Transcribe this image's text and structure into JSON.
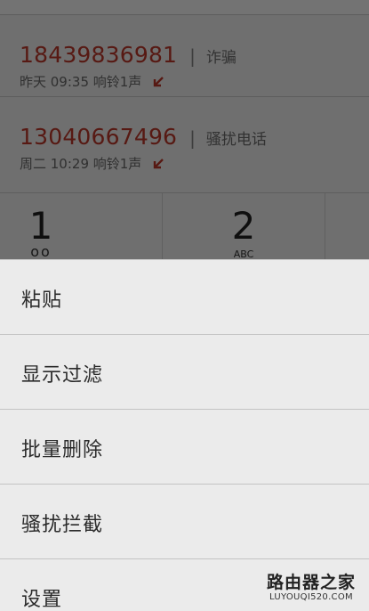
{
  "call_log": [
    {
      "number": "18439836981",
      "tag": "诈骗",
      "time": "昨天 09:35 响铃1声",
      "status_icon": "missed-call-icon"
    },
    {
      "number": "13040667496",
      "tag": "骚扰电话",
      "time": "周二 10:29 响铃1声",
      "status_icon": "missed-call-icon"
    }
  ],
  "separator": "|",
  "dialpad": {
    "keys": [
      {
        "digit": "1",
        "sub": "oo"
      },
      {
        "digit": "2",
        "sub": "ABC"
      },
      {
        "digit": "",
        "sub": ""
      }
    ]
  },
  "menu": {
    "items": [
      {
        "label": "粘贴"
      },
      {
        "label": "显示过滤"
      },
      {
        "label": "批量删除"
      },
      {
        "label": "骚扰拦截"
      },
      {
        "label": "设置"
      }
    ]
  },
  "watermark": {
    "main": "路由器之家",
    "sub": "LUYOUQI520.COM"
  },
  "colors": {
    "number_red": "#c0392b",
    "sheet_bg": "#ebebeb",
    "overlay": "rgba(0,0,0,0.55)"
  }
}
